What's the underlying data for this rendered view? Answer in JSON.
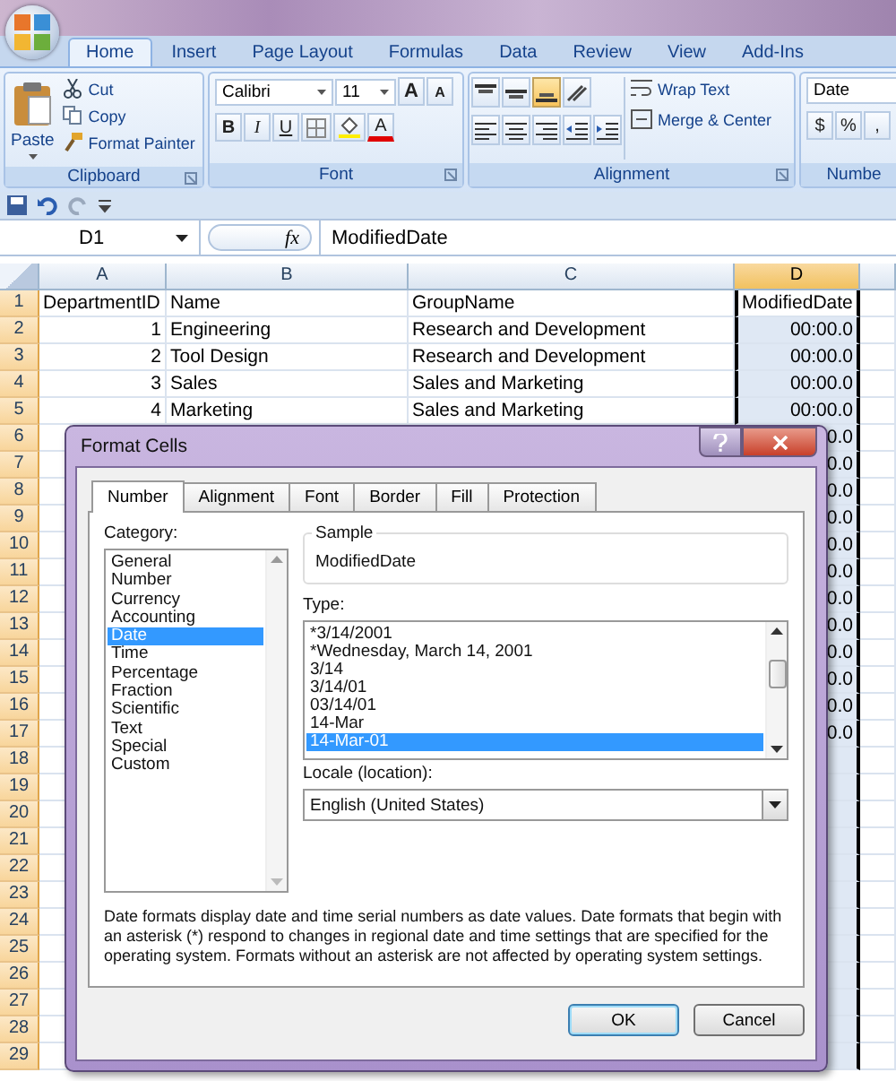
{
  "ribbon_tabs": [
    {
      "label": "Home",
      "selected": true
    },
    {
      "label": "Insert",
      "selected": false
    },
    {
      "label": "Page Layout",
      "selected": false
    },
    {
      "label": "Formulas",
      "selected": false
    },
    {
      "label": "Data",
      "selected": false
    },
    {
      "label": "Review",
      "selected": false
    },
    {
      "label": "View",
      "selected": false
    },
    {
      "label": "Add-Ins",
      "selected": false
    }
  ],
  "clipboard": {
    "label": "Clipboard",
    "paste": "Paste",
    "cut": "Cut",
    "copy": "Copy",
    "format_painter": "Format Painter"
  },
  "font": {
    "label": "Font",
    "font_name": "Calibri",
    "font_size": "11",
    "grow": "A",
    "shrink": "A",
    "bold": "B",
    "italic": "I",
    "underline": "U",
    "font_color": "A"
  },
  "alignment": {
    "label": "Alignment",
    "wrap_text": "Wrap Text",
    "merge_center": "Merge & Center",
    "buttons": [
      {
        "kind": "top",
        "selected": false
      },
      {
        "kind": "middle",
        "selected": false
      },
      {
        "kind": "bottom",
        "selected": true
      },
      {
        "kind": "orientation",
        "selected": false
      },
      {
        "kind": "left",
        "selected": false
      },
      {
        "kind": "center",
        "selected": false
      },
      {
        "kind": "right",
        "selected": false
      },
      {
        "kind": "outdent",
        "selected": false
      },
      {
        "kind": "indent",
        "selected": false
      }
    ]
  },
  "number": {
    "label": "Numbe",
    "format": "Date",
    "currency": "$",
    "percent": "%",
    "comma": ","
  },
  "formula_bar": {
    "name_box": "D1",
    "fx": "fx",
    "value": "ModifiedDate"
  },
  "sheet": {
    "columns": [
      {
        "label": "A",
        "kind": "number",
        "selected": false
      },
      {
        "label": "B",
        "kind": "text",
        "selected": false
      },
      {
        "label": "C",
        "kind": "text",
        "selected": false
      },
      {
        "label": "D",
        "kind": "date",
        "selected": true
      }
    ],
    "rows": [
      {
        "num": "1",
        "kind": "header",
        "cells": {
          "a": "DepartmentID",
          "b": "Name",
          "c": "GroupName",
          "d": "ModifiedDate"
        }
      },
      {
        "num": "2",
        "kind": "data",
        "cells": {
          "a": "1",
          "b": "Engineering",
          "c": "Research and Development",
          "d": "00:00.0"
        }
      },
      {
        "num": "3",
        "kind": "data",
        "cells": {
          "a": "2",
          "b": "Tool Design",
          "c": "Research and Development",
          "d": "00:00.0"
        }
      },
      {
        "num": "4",
        "kind": "data",
        "cells": {
          "a": "3",
          "b": "Sales",
          "c": "Sales and Marketing",
          "d": "00:00.0"
        }
      },
      {
        "num": "5",
        "kind": "data",
        "cells": {
          "a": "4",
          "b": "Marketing",
          "c": "Sales and Marketing",
          "d": "00:00.0"
        }
      },
      {
        "num": "6",
        "kind": "data",
        "cells": {
          "d": "0.0"
        }
      },
      {
        "num": "7",
        "kind": "data",
        "cells": {
          "d": "0.0"
        }
      },
      {
        "num": "8",
        "kind": "data",
        "cells": {
          "d": "0.0"
        }
      },
      {
        "num": "9",
        "kind": "data",
        "cells": {
          "d": "0.0"
        }
      },
      {
        "num": "10",
        "kind": "data",
        "cells": {
          "d": "0.0"
        }
      },
      {
        "num": "11",
        "kind": "data",
        "cells": {
          "d": "0.0"
        }
      },
      {
        "num": "12",
        "kind": "data",
        "cells": {
          "d": "0.0"
        }
      },
      {
        "num": "13",
        "kind": "data",
        "cells": {
          "d": "0.0"
        }
      },
      {
        "num": "14",
        "kind": "data",
        "cells": {
          "d": "0.0"
        }
      },
      {
        "num": "15",
        "kind": "data",
        "cells": {
          "d": "0.0"
        }
      },
      {
        "num": "16",
        "kind": "data",
        "cells": {
          "d": "0.0"
        }
      },
      {
        "num": "17",
        "kind": "data",
        "cells": {
          "d": "0.0"
        }
      },
      {
        "num": "18",
        "kind": "data"
      },
      {
        "num": "19",
        "kind": "data"
      },
      {
        "num": "20",
        "kind": "data"
      },
      {
        "num": "21",
        "kind": "data"
      },
      {
        "num": "22",
        "kind": "data"
      },
      {
        "num": "23",
        "kind": "data"
      },
      {
        "num": "24",
        "kind": "data"
      },
      {
        "num": "25",
        "kind": "data"
      },
      {
        "num": "26",
        "kind": "data"
      },
      {
        "num": "27",
        "kind": "data"
      },
      {
        "num": "28",
        "kind": "data"
      },
      {
        "num": "29",
        "kind": "data"
      }
    ]
  },
  "dialog": {
    "title": "Format Cells",
    "tabs": [
      {
        "label": "Number",
        "selected": true
      },
      {
        "label": "Alignment",
        "selected": false
      },
      {
        "label": "Font",
        "selected": false
      },
      {
        "label": "Border",
        "selected": false
      },
      {
        "label": "Fill",
        "selected": false
      },
      {
        "label": "Protection",
        "selected": false
      }
    ],
    "category_label": "Category:",
    "categories": [
      {
        "label": "General",
        "selected": false
      },
      {
        "label": "Number",
        "selected": false
      },
      {
        "label": "Currency",
        "selected": false
      },
      {
        "label": "Accounting",
        "selected": false
      },
      {
        "label": "Date",
        "selected": true
      },
      {
        "label": "Time",
        "selected": false
      },
      {
        "label": "Percentage",
        "selected": false
      },
      {
        "label": "Fraction",
        "selected": false
      },
      {
        "label": "Scientific",
        "selected": false
      },
      {
        "label": "Text",
        "selected": false
      },
      {
        "label": "Special",
        "selected": false
      },
      {
        "label": "Custom",
        "selected": false
      }
    ],
    "sample_label": "Sample",
    "sample_value": "ModifiedDate",
    "type_label": "Type:",
    "types": [
      {
        "label": "*3/14/2001",
        "selected": false
      },
      {
        "label": "*Wednesday, March 14, 2001",
        "selected": false
      },
      {
        "label": "3/14",
        "selected": false
      },
      {
        "label": "3/14/01",
        "selected": false
      },
      {
        "label": "03/14/01",
        "selected": false
      },
      {
        "label": "14-Mar",
        "selected": false
      },
      {
        "label": "14-Mar-01",
        "selected": true
      }
    ],
    "locale_label": "Locale (location):",
    "locale_value": "English (United States)",
    "description": "Date formats display date and time serial numbers as date values.  Date formats that begin with an asterisk (*) respond to changes in regional date and time settings that are specified for the operating system. Formats without an asterisk are not affected by operating system settings.",
    "ok": "OK",
    "cancel": "Cancel"
  }
}
